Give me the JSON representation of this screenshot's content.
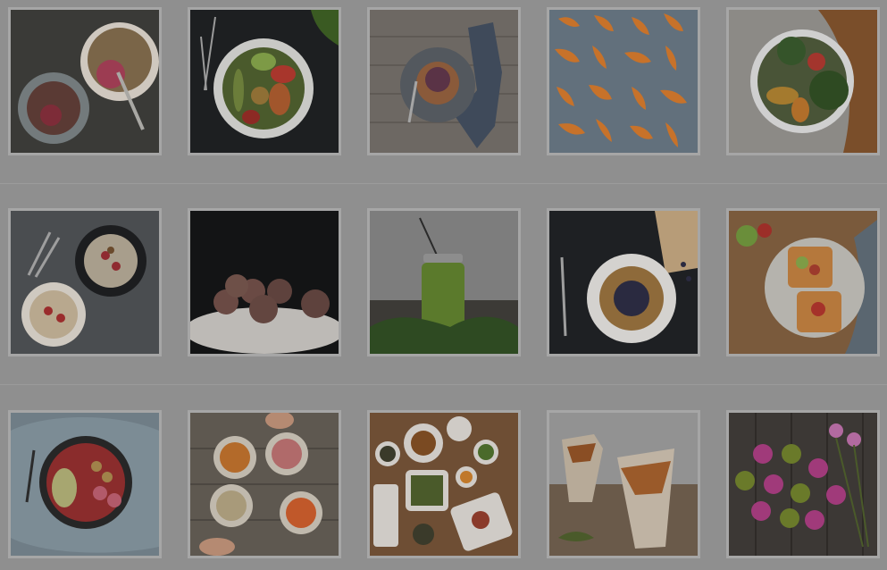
{
  "gallery": {
    "tiles": [
      {
        "subject": "granola-bowls-photo"
      },
      {
        "subject": "vegetable-plate-photo"
      },
      {
        "subject": "pancake-plate-photo"
      },
      {
        "subject": "roasted-squash-photo"
      },
      {
        "subject": "broccoli-salad-photo"
      },
      {
        "subject": "porridge-bowls-photo"
      },
      {
        "subject": "coconut-balls-photo"
      },
      {
        "subject": "green-smoothie-photo"
      },
      {
        "subject": "waffle-plate-photo"
      },
      {
        "subject": "avocado-toast-photo"
      },
      {
        "subject": "smoothie-bowl-photo"
      },
      {
        "subject": "shared-bowls-photo"
      },
      {
        "subject": "buffet-spread-photo"
      },
      {
        "subject": "sweet-potato-fries-photo"
      },
      {
        "subject": "flower-cupcakes-photo"
      }
    ]
  },
  "colors": {
    "background": "#8f8f8f",
    "tile_border": "#a6a6a6",
    "divider": "#9b9b9b"
  }
}
